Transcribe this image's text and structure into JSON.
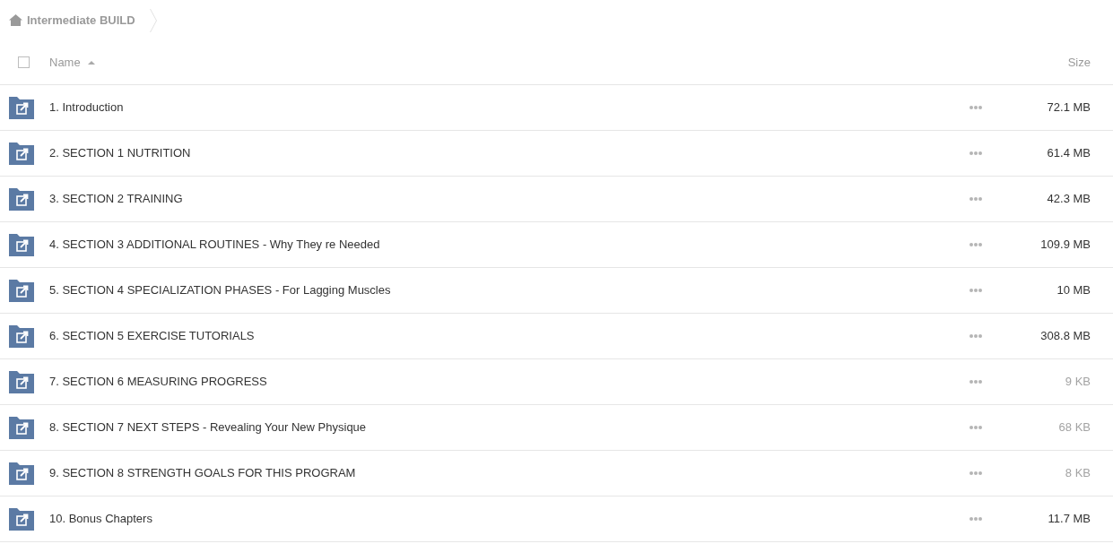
{
  "breadcrumb": {
    "items": [
      {
        "label": "Intermediate BUILD"
      }
    ]
  },
  "table": {
    "select_all": {
      "checked": false
    },
    "columns": [
      {
        "label": "Name",
        "sorted": true
      },
      {
        "label": "Size",
        "sorted": false
      }
    ],
    "rows": [
      {
        "name": "1. Introduction",
        "size": "72.1 MB",
        "size_muted": false
      },
      {
        "name": "2. SECTION 1 NUTRITION",
        "size": "61.4 MB",
        "size_muted": false
      },
      {
        "name": "3. SECTION 2 TRAINING",
        "size": "42.3 MB",
        "size_muted": false
      },
      {
        "name": "4. SECTION 3 ADDITIONAL ROUTINES - Why They re Needed",
        "size": "109.9 MB",
        "size_muted": false
      },
      {
        "name": "5. SECTION 4 SPECIALIZATION PHASES - For Lagging Muscles",
        "size": "10 MB",
        "size_muted": false
      },
      {
        "name": "6. SECTION 5 EXERCISE TUTORIALS",
        "size": "308.8 MB",
        "size_muted": false
      },
      {
        "name": "7. SECTION 6 MEASURING PROGRESS",
        "size": "9 KB",
        "size_muted": true
      },
      {
        "name": "8. SECTION 7 NEXT STEPS - Revealing Your New Physique",
        "size": "68 KB",
        "size_muted": true
      },
      {
        "name": "9. SECTION 8 STRENGTH GOALS FOR THIS PROGRAM",
        "size": "8 KB",
        "size_muted": true
      },
      {
        "name": "10. Bonus Chapters",
        "size": "11.7 MB",
        "size_muted": false
      }
    ]
  }
}
